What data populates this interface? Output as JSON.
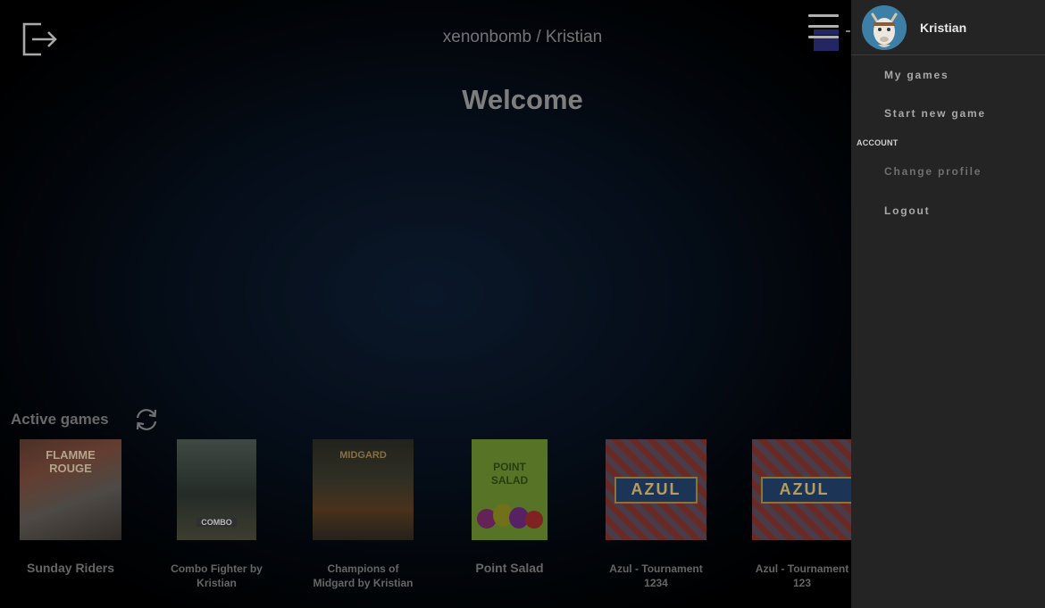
{
  "header": {
    "breadcrumb": "xenonbomb / Kristian",
    "welcome": "Welcome",
    "logout_icon": "logout-icon",
    "menu_icon": "hamburger-menu-icon"
  },
  "active_games": {
    "title": "Active games",
    "refresh_icon": "refresh-icon",
    "games": [
      {
        "name_line1": "Sunday Riders",
        "name_line2": "",
        "cover_text": "FLAMME ROUGE"
      },
      {
        "name_line1": "Combo Fighter by",
        "name_line2": "Kristian",
        "cover_text": "COMBO"
      },
      {
        "name_line1": "Champions of",
        "name_line2": "Midgard by Kristian",
        "cover_text": "MIDGARD"
      },
      {
        "name_line1": "Point Salad",
        "name_line2": "",
        "cover_text": "POINT SALAD"
      },
      {
        "name_line1": "Azul - Tournament",
        "name_line2": "1234",
        "cover_text": "AZUL"
      },
      {
        "name_line1": "Azul - Tournament",
        "name_line2": "123",
        "cover_text": "AZUL"
      }
    ]
  },
  "drawer": {
    "user_name": "Kristian",
    "items": [
      {
        "label": "My games"
      },
      {
        "label": "Start new game"
      }
    ],
    "account_header": "ACCOUNT",
    "account_items": [
      {
        "label": "Change profile",
        "disabled": true
      },
      {
        "label": "Logout"
      }
    ]
  },
  "colors": {
    "background": "#07111f",
    "drawer": "#242424",
    "text_dim": "#8e8e8e"
  }
}
